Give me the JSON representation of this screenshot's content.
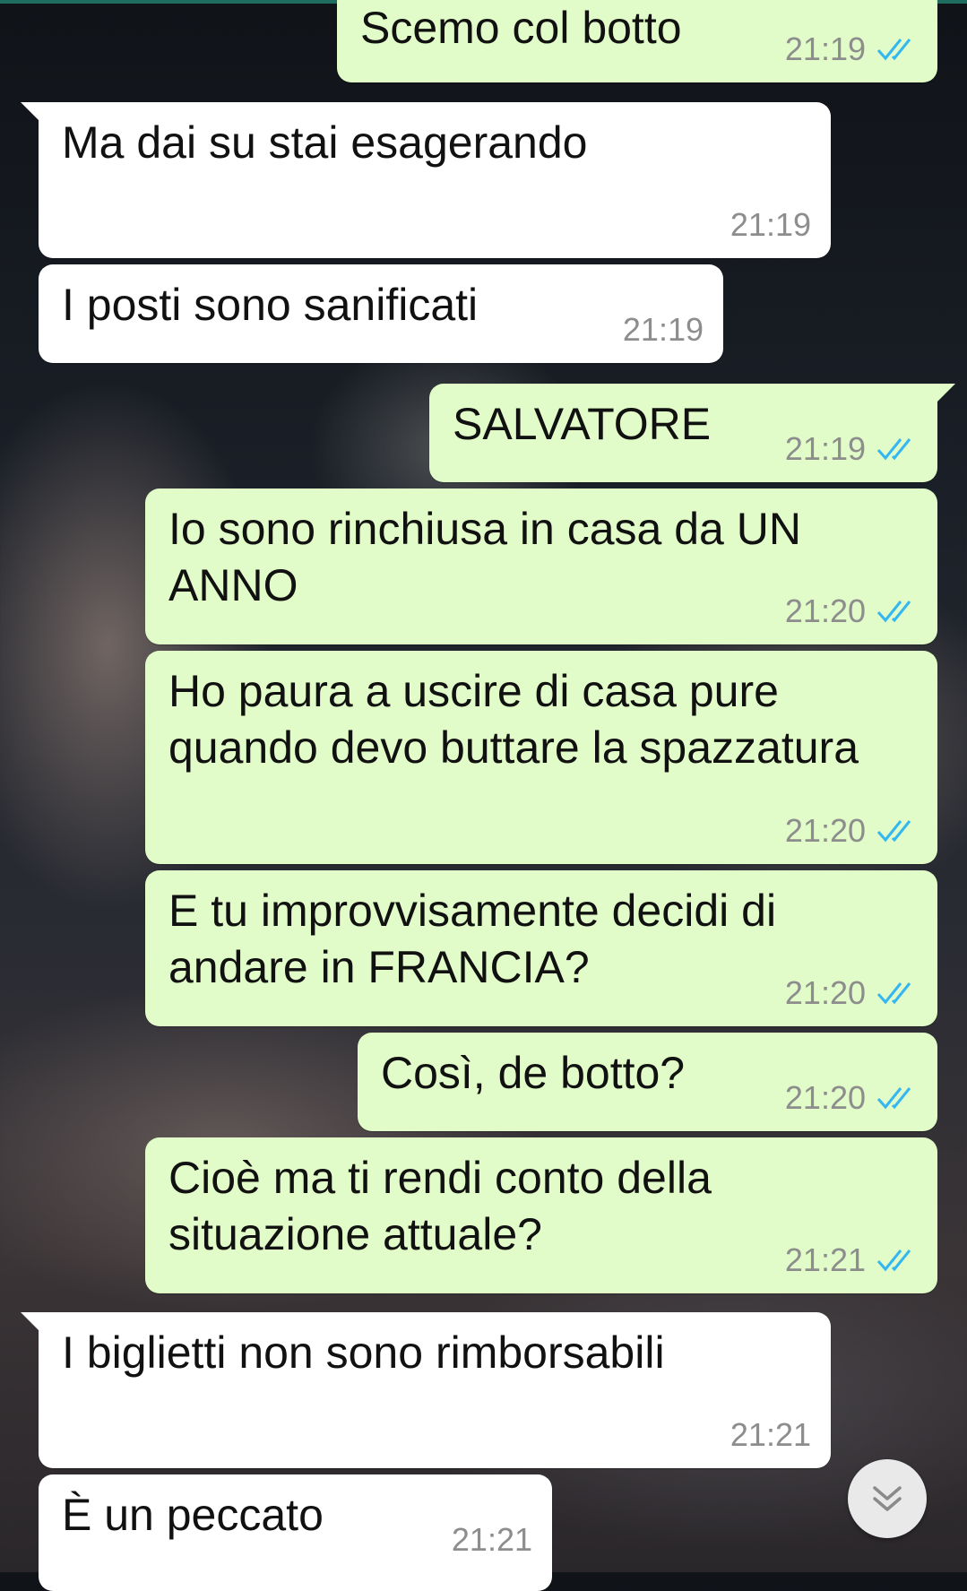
{
  "colors": {
    "incoming_bubble": "#ffffff",
    "outgoing_bubble": "#e1fcc8",
    "read_ticks": "#34b7f1",
    "timestamp": "#8d8d8d"
  },
  "messages": [
    {
      "direction": "outgoing",
      "text": "Scemo col botto",
      "time": "21:19",
      "status": "read"
    },
    {
      "direction": "incoming",
      "text": "Ma dai su stai esagerando",
      "time": "21:19"
    },
    {
      "direction": "incoming",
      "text": "I posti sono sanificati",
      "time": "21:19"
    },
    {
      "direction": "outgoing",
      "text": "SALVATORE",
      "time": "21:19",
      "status": "read"
    },
    {
      "direction": "outgoing",
      "text": "Io sono rinchiusa in casa da UN ANNO",
      "time": "21:20",
      "status": "read"
    },
    {
      "direction": "outgoing",
      "text": "Ho paura a uscire di casa pure quando devo buttare la spazzatura",
      "time": "21:20",
      "status": "read"
    },
    {
      "direction": "outgoing",
      "text": "E tu improvvisamente decidi di andare in FRANCIA?",
      "time": "21:20",
      "status": "read"
    },
    {
      "direction": "outgoing",
      "text": "Così, de botto?",
      "time": "21:20",
      "status": "read"
    },
    {
      "direction": "outgoing",
      "text": "Cioè ma ti rendi conto della situazione attuale?",
      "time": "21:21",
      "status": "read"
    },
    {
      "direction": "incoming",
      "text": "I biglietti non sono rimborsabili",
      "time": "21:21"
    },
    {
      "direction": "incoming",
      "text": "È un peccato",
      "time": "21:21"
    }
  ],
  "scroll_button": {
    "icon": "double-chevron-down-icon"
  }
}
